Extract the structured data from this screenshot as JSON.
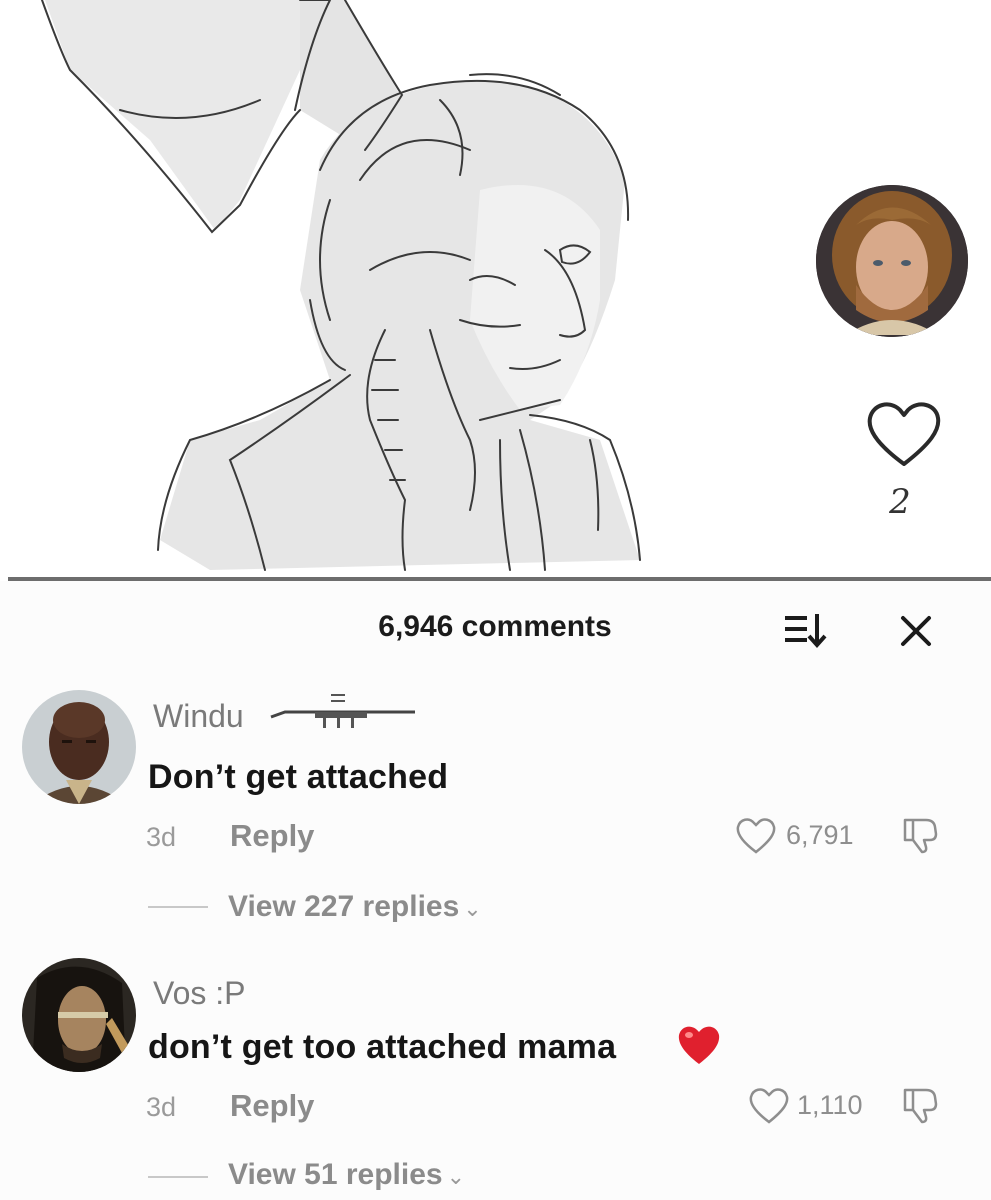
{
  "post": {
    "like_count": "2",
    "icons": {
      "like": "heart-outline-icon",
      "creator": "creator-avatar"
    }
  },
  "comments_panel": {
    "title": "6,946 comments",
    "icons": {
      "sort": "sort-icon",
      "close": "close-icon"
    }
  },
  "comments": [
    {
      "username": "Windu",
      "text": "Don’t get attached",
      "age": "3d",
      "reply_label": "Reply",
      "likes": "6,791",
      "view_replies": "View 227 replies",
      "icons": {
        "like": "heart-outline-icon",
        "dislike": "dislike-icon",
        "decoration": "lightsaber-icon"
      }
    },
    {
      "username": "Vos :P",
      "text": "don’t get too attached mama",
      "age": "3d",
      "reply_label": "Reply",
      "likes": "1,110",
      "view_replies": "View 51 replies",
      "icons": {
        "like": "heart-outline-icon",
        "dislike": "dislike-icon",
        "emoji": "red-heart-emoji"
      }
    }
  ],
  "colors": {
    "panel_bg": "#fcfcfc",
    "muted_text": "#8b8b8b",
    "emoji_heart": "#e0202e"
  }
}
